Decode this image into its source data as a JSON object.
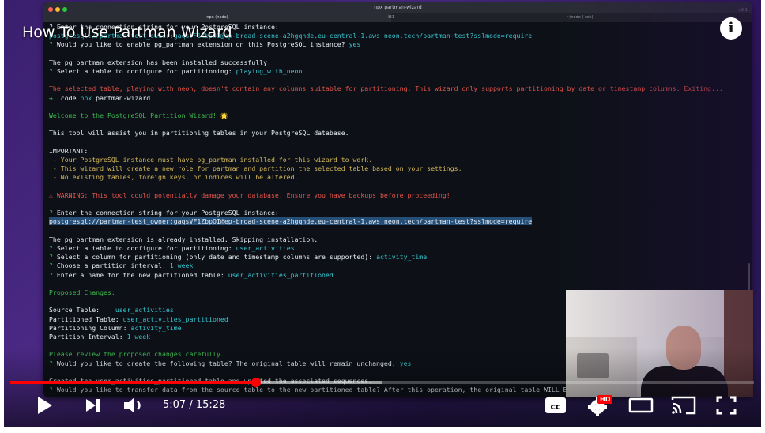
{
  "video": {
    "title": "How To Use Partman Wizard",
    "current_time": "5:07",
    "duration": "15:28",
    "time_display": "5:07 / 15:28",
    "progress_fraction": 0.331,
    "buffered_fraction": 0.5,
    "accent_color": "#ff0000",
    "hd_badge": "HD",
    "cc_label": "cc"
  },
  "terminal": {
    "window_title": "npx partman-wizard",
    "tabs": [
      {
        "label": "npx (node)"
      },
      {
        "label": "⌘1"
      },
      {
        "label": "~/node (-zsh)"
      }
    ],
    "shortcut": "⌥⌘1",
    "lines": [
      {
        "segs": [
          {
            "t": "? Enter the connection string for your PostgreSQL instance: ",
            "c": "white"
          }
        ]
      },
      {
        "segs": [
          {
            "t": "postgresql://partman-test_owner:gaqsVF1ZbpOI@ep-broad-scene-a2hgqhde.eu-central-1.aws.neon.tech/partman-test?sslmode=require",
            "c": "cyan"
          }
        ]
      },
      {
        "segs": [
          {
            "t": "? ",
            "c": "green"
          },
          {
            "t": "Would you like to enable pg_partman extension on this PostgreSQL instance? ",
            "c": "white"
          },
          {
            "t": "yes",
            "c": "cyan"
          }
        ]
      },
      {
        "segs": [
          {
            "t": "",
            "c": "white"
          }
        ]
      },
      {
        "segs": [
          {
            "t": "The pg_partman extension has been installed successfully.",
            "c": "white"
          }
        ]
      },
      {
        "segs": [
          {
            "t": "? ",
            "c": "green"
          },
          {
            "t": "Select a table to configure for partitioning: ",
            "c": "white"
          },
          {
            "t": "playing_with_neon",
            "c": "cyan"
          }
        ]
      },
      {
        "segs": [
          {
            "t": "",
            "c": "white"
          }
        ]
      },
      {
        "segs": [
          {
            "t": "The selected table, playing_with_neon, doesn't contain any columns suitable for partitioning. This wizard only supports partitioning by date or timestamp columns. Exiting...",
            "c": "red"
          }
        ]
      },
      {
        "segs": [
          {
            "t": "→  ",
            "c": "green"
          },
          {
            "t": "code ",
            "c": "white"
          },
          {
            "t": "npx",
            "c": "cyan"
          },
          {
            "t": " partman-wizard",
            "c": "white"
          }
        ]
      },
      {
        "segs": [
          {
            "t": "",
            "c": "white"
          }
        ]
      },
      {
        "segs": [
          {
            "t": "Welcome to the PostgreSQL Partition Wizard! 🌟",
            "c": "green"
          }
        ]
      },
      {
        "segs": [
          {
            "t": "",
            "c": "white"
          }
        ]
      },
      {
        "segs": [
          {
            "t": "This tool will assist you in partitioning tables in your PostgreSQL database.",
            "c": "white"
          }
        ]
      },
      {
        "segs": [
          {
            "t": "",
            "c": "white"
          }
        ]
      },
      {
        "segs": [
          {
            "t": "IMPORTANT:",
            "c": "white"
          }
        ]
      },
      {
        "segs": [
          {
            "t": " - Your PostgreSQL instance must have pg_partman installed for this wizard to work.",
            "c": "yellow"
          }
        ]
      },
      {
        "segs": [
          {
            "t": " - This wizard will create a new role for partman and partition the selected table based on your settings.",
            "c": "yellow"
          }
        ]
      },
      {
        "segs": [
          {
            "t": " - No existing tables, foreign keys, or indices will be altered.",
            "c": "yellow"
          }
        ]
      },
      {
        "segs": [
          {
            "t": "",
            "c": "white"
          }
        ]
      },
      {
        "segs": [
          {
            "t": "⚠ WARNING: This tool could potentially damage your database. Ensure you have backups before proceeding!",
            "c": "red"
          }
        ]
      },
      {
        "segs": [
          {
            "t": "",
            "c": "white"
          }
        ]
      },
      {
        "segs": [
          {
            "t": "? ",
            "c": "green"
          },
          {
            "t": "Enter the connection string for your PostgreSQL instance:",
            "c": "white"
          }
        ]
      },
      {
        "segs": [
          {
            "t": "postgresql://partman-test_owner:gaqsVF1ZbpOI@ep-broad-scene-a2hgqhde.eu-central-1.aws.neon.tech/partman-test?sslmode=require",
            "c": "hl"
          }
        ]
      },
      {
        "segs": [
          {
            "t": "",
            "c": "white"
          }
        ]
      },
      {
        "segs": [
          {
            "t": "The pg_partman extension is already installed. Skipping installation.",
            "c": "white"
          }
        ]
      },
      {
        "segs": [
          {
            "t": "? ",
            "c": "green"
          },
          {
            "t": "Select a table to configure for partitioning: ",
            "c": "white"
          },
          {
            "t": "user_activities",
            "c": "cyan"
          }
        ]
      },
      {
        "segs": [
          {
            "t": "? ",
            "c": "green"
          },
          {
            "t": "Select a column for partitioning (only date and timestamp columns are supported): ",
            "c": "white"
          },
          {
            "t": "activity_time",
            "c": "cyan"
          }
        ]
      },
      {
        "segs": [
          {
            "t": "? ",
            "c": "green"
          },
          {
            "t": "Choose a partition interval: ",
            "c": "white"
          },
          {
            "t": "1 week",
            "c": "cyan"
          }
        ]
      },
      {
        "segs": [
          {
            "t": "? ",
            "c": "green"
          },
          {
            "t": "Enter a name for the new partitioned table: ",
            "c": "white"
          },
          {
            "t": "user_activities_partitioned",
            "c": "cyan"
          }
        ]
      },
      {
        "segs": [
          {
            "t": "",
            "c": "white"
          }
        ]
      },
      {
        "segs": [
          {
            "t": "Proposed Changes:",
            "c": "green"
          }
        ]
      },
      {
        "segs": [
          {
            "t": "",
            "c": "white"
          }
        ]
      },
      {
        "segs": [
          {
            "t": "Source Table:    ",
            "c": "white"
          },
          {
            "t": "user_activities",
            "c": "cyan"
          }
        ]
      },
      {
        "segs": [
          {
            "t": "Partitioned Table: ",
            "c": "white"
          },
          {
            "t": "user_activities_partitioned",
            "c": "cyan"
          }
        ]
      },
      {
        "segs": [
          {
            "t": "Partitioning Column: ",
            "c": "white"
          },
          {
            "t": "activity_time",
            "c": "cyan"
          }
        ]
      },
      {
        "segs": [
          {
            "t": "Partition Interval: ",
            "c": "white"
          },
          {
            "t": "1 week",
            "c": "cyan"
          }
        ]
      },
      {
        "segs": [
          {
            "t": "",
            "c": "white"
          }
        ]
      },
      {
        "segs": [
          {
            "t": "Please review the proposed changes carefully.",
            "c": "green"
          }
        ]
      },
      {
        "segs": [
          {
            "t": "? ",
            "c": "green"
          },
          {
            "t": "Would you like to create the following table? The original table will remain unchanged. ",
            "c": "white"
          },
          {
            "t": "yes",
            "c": "cyan"
          }
        ]
      },
      {
        "segs": [
          {
            "t": "",
            "c": "white"
          }
        ]
      },
      {
        "segs": [
          {
            "t": "Created the user_activities_partitioned table and updated the associated sequences.",
            "c": "white"
          }
        ]
      },
      {
        "segs": [
          {
            "t": "? ",
            "c": "green"
          },
          {
            "t": "Would you like to transfer data from the source table to the new partitioned table? After this operation, the original table WILL BE R",
            "c": "white"
          }
        ]
      }
    ]
  }
}
